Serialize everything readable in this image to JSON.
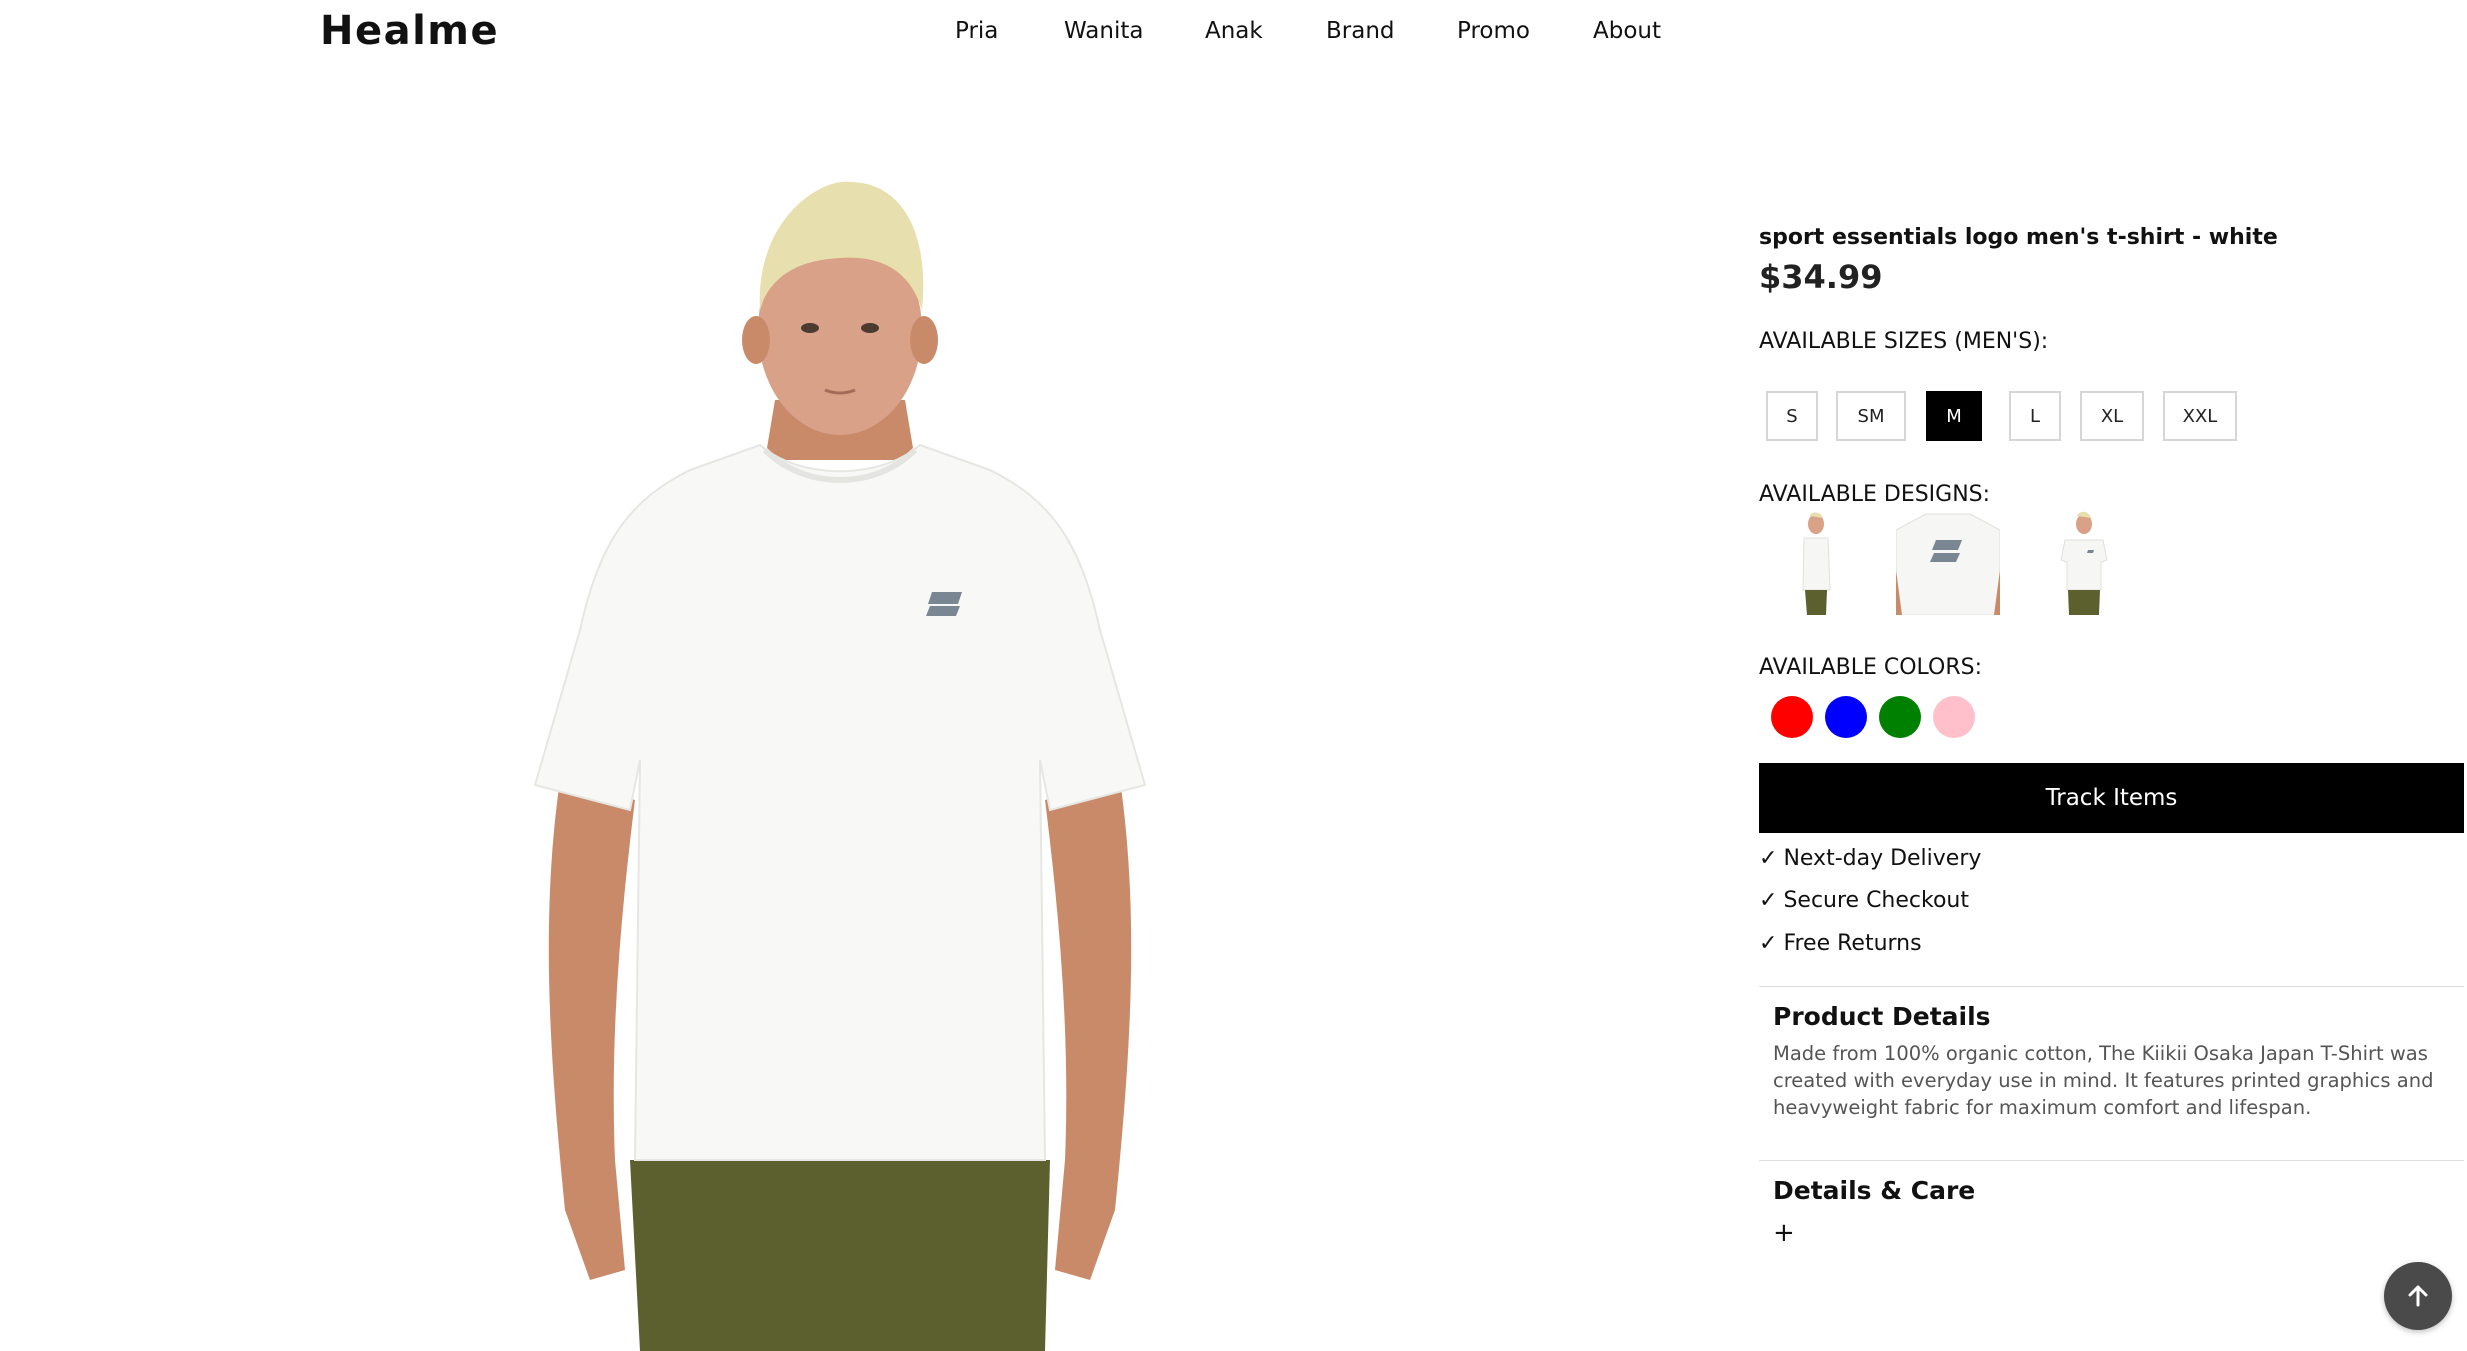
{
  "header": {
    "logo": "Healme",
    "nav": [
      "Pria",
      "Wanita",
      "Anak",
      "Brand",
      "Promo",
      "About"
    ]
  },
  "product": {
    "title": "sport essentials logo men's t-shirt - white",
    "price": "$34.99",
    "image_icon": "product-model-photo"
  },
  "sizes": {
    "label": "AVAILABLE SIZES (MEN'S):",
    "options": [
      "S",
      "SM",
      "M",
      "L",
      "XL",
      "XXL"
    ],
    "selected": "M"
  },
  "designs": {
    "label": "AVAILABLE DESIGNS:",
    "thumbnails": [
      "side-view-thumbnail",
      "back-logo-thumbnail",
      "front-view-thumbnail"
    ]
  },
  "colors": {
    "label": "AVAILABLE COLORS:",
    "swatches": [
      "#ff0000",
      "#0000ff",
      "#008000",
      "#ffc0cb"
    ]
  },
  "actions": {
    "track_label": "Track Items"
  },
  "perks": [
    "Next-day Delivery",
    "Secure Checkout",
    "Free Returns"
  ],
  "perk_icon": "checkmark-icon",
  "details": {
    "title": "Product Details",
    "text": "Made from 100% organic cotton, The Kiikii Osaka Japan T-Shirt was created with everyday use in mind. It features printed graphics and heavyweight fabric for maximum comfort and lifespan."
  },
  "care": {
    "title": "Details & Care",
    "toggle": "+"
  },
  "scroll_top_icon": "arrow-up-icon"
}
